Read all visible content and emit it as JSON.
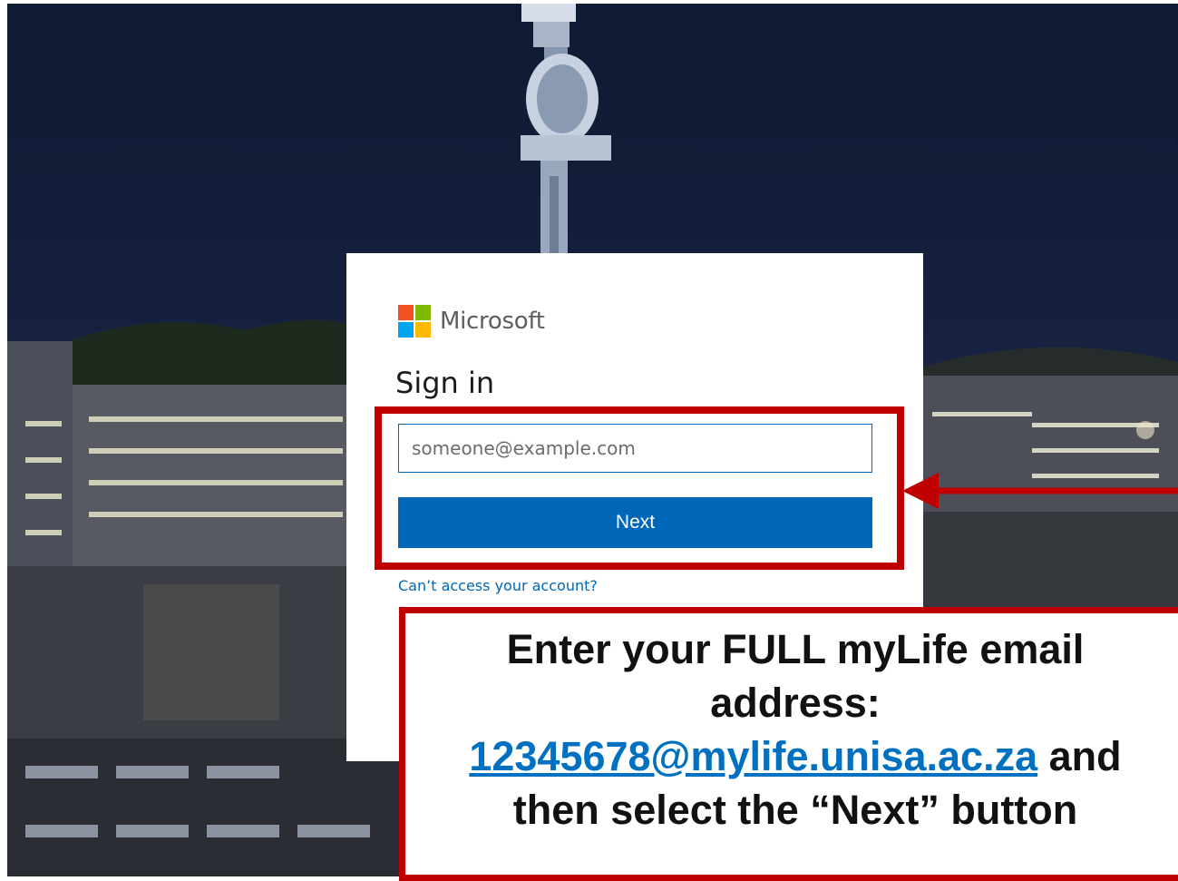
{
  "signin": {
    "brand": "Microsoft",
    "title": "Sign in",
    "email_placeholder": "someone@example.com",
    "next_label": "Next",
    "cant_access_label": "Can’t access your account?"
  },
  "callout": {
    "line1": "Enter your FULL myLife email",
    "line2": "address:",
    "email_link": "12345678@mylife.unisa.ac.za",
    "line3_suffix": " and",
    "line4": "then select the “Next” button"
  },
  "colors": {
    "accent": "#0067b8",
    "annotation_red": "#c00000",
    "link_blue": "#0070c0",
    "logo_red": "#f25022",
    "logo_green": "#7fba00",
    "logo_blue": "#00a4ef",
    "logo_yellow": "#ffb900"
  },
  "icons": [
    "microsoft-logo-icon",
    "arrow-left-icon"
  ]
}
